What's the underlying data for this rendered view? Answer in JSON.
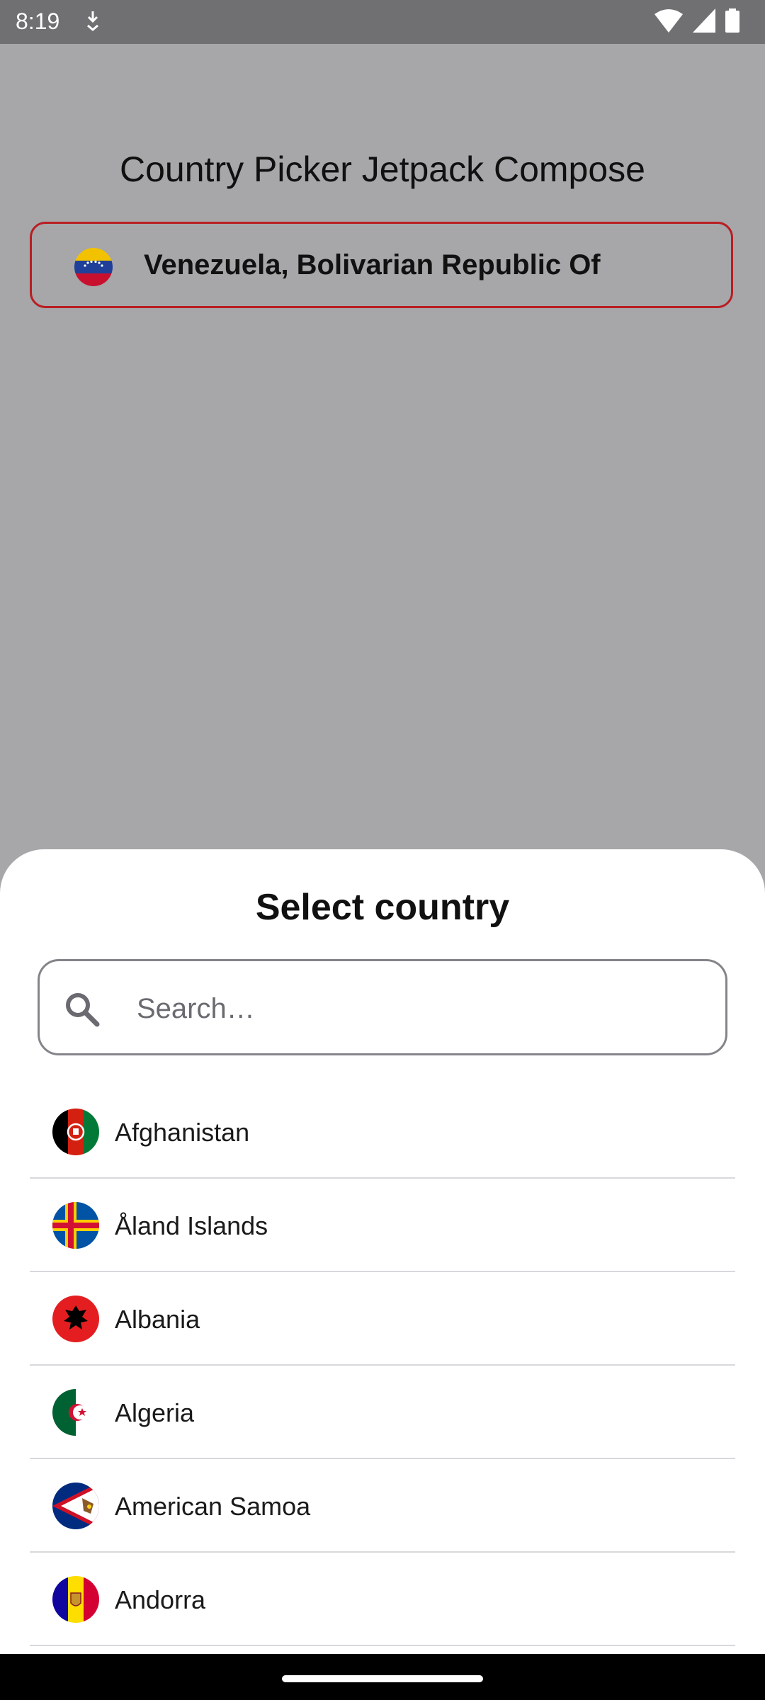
{
  "status_bar": {
    "time": "8:19"
  },
  "app": {
    "title": "Country Picker Jetpack Compose",
    "selected_country": "Venezuela, Bolivarian Republic Of"
  },
  "sheet": {
    "title": "Select country",
    "search": {
      "placeholder": "Search…",
      "value": ""
    },
    "countries": [
      {
        "name": "Afghanistan",
        "flag": "afghanistan-flag"
      },
      {
        "name": "Åland Islands",
        "flag": "aland-islands-flag"
      },
      {
        "name": "Albania",
        "flag": "albania-flag"
      },
      {
        "name": "Algeria",
        "flag": "algeria-flag"
      },
      {
        "name": "American Samoa",
        "flag": "american-samoa-flag"
      },
      {
        "name": "Andorra",
        "flag": "andorra-flag"
      }
    ]
  },
  "colors": {
    "scrim": "#a7a6a9",
    "status_bar": "#707072",
    "accent_border": "#b81e22",
    "sheet": "#ffffff"
  }
}
